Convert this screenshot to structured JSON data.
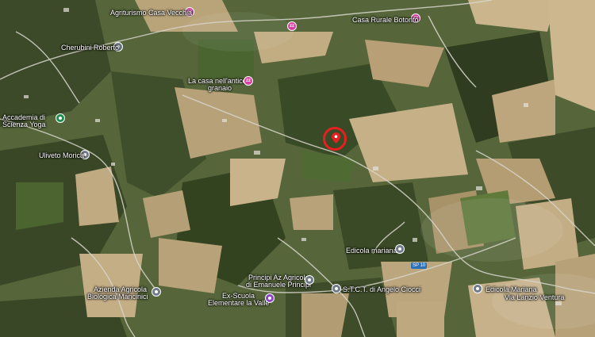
{
  "map": {
    "places": [
      {
        "name": "Agriturismo Casa Vecchia",
        "kind": "lodging",
        "color": "#d63fa0"
      },
      {
        "name": "Casa Rurale Botonto",
        "kind": "lodging",
        "color": "#d63fa0"
      },
      {
        "name": "Cherubini Roberto",
        "kind": "place",
        "color": "#6f7b87"
      },
      {
        "name": "La casa nell'antico granaio",
        "kind": "lodging",
        "color": "#d63fa0"
      },
      {
        "name": "Accademia di Scienza Yoga",
        "kind": "school",
        "color": "#1e8e4f"
      },
      {
        "name": "Uliveto Morica",
        "kind": "place",
        "color": "#6f7b87"
      },
      {
        "name": "Edicola mariana",
        "kind": "place",
        "color": "#6f7b87"
      },
      {
        "name": "Principi Az Agricola di Emanuele Principi",
        "kind": "place",
        "color": "#6f7b87"
      },
      {
        "name": "S.T.C.T. di Angelo Ciocci",
        "kind": "place",
        "color": "#6f7b87"
      },
      {
        "name": "Azienda Agricola Biologica Mancinici",
        "kind": "place",
        "color": "#6f7b87"
      },
      {
        "name": "Ex-Scuola Elementare la Valle",
        "kind": "school",
        "color": "#8a46c8"
      },
      {
        "name": "Edicola Mariana",
        "kind": "place",
        "color": "#6f7b87"
      },
      {
        "name": "Via Lanzio Ventura",
        "kind": "road",
        "color": "#ffffff"
      }
    ],
    "road_shield": "SP 10",
    "target_color": "#e62020"
  }
}
